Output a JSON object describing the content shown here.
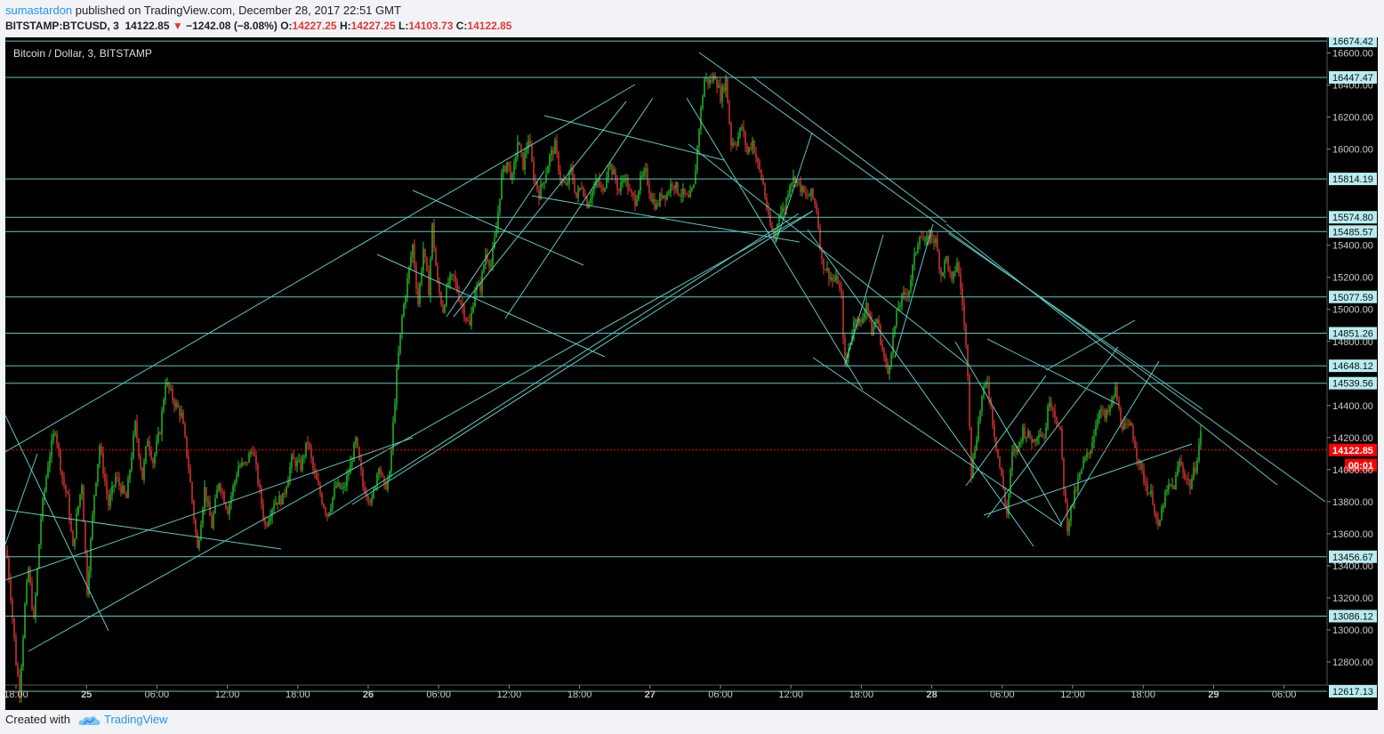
{
  "header": {
    "publisher": "sumastardon",
    "published_text": " published on TradingView.com, December 28, 2017 22:51 GMT",
    "symbol": "BITSTAMP:BTCUSD, 3",
    "last": "14122.85",
    "change": "−1242.08 (−8.08%)",
    "open_label": "O:",
    "open": "14227.25",
    "high_label": "H:",
    "high": "14227.25",
    "low_label": "L:",
    "low": "14103.73",
    "close_label": "C:",
    "close": "14122.85"
  },
  "chart_title": "Bitcoin / Dollar, 3, BITSTAMP",
  "footer": {
    "created_with": "Created with",
    "brand": "TradingView"
  },
  "colors": {
    "background": "#000000",
    "line": "#5ec8c0",
    "up": "#26c828",
    "down": "#e53935",
    "price_label_bg": "#b8ecf0",
    "last_price_bg": "#ff0000",
    "accent": "#2196f3"
  },
  "chart_data": {
    "type": "candlestick",
    "title": "Bitcoin / Dollar, 3, BITSTAMP",
    "x_ticks": [
      "18:00",
      "25",
      "06:00",
      "12:00",
      "18:00",
      "26",
      "06:00",
      "12:00",
      "18:00",
      "27",
      "06:00",
      "12:00",
      "18:00",
      "28",
      "06:00",
      "12:00",
      "18:00",
      "29",
      "06:00"
    ],
    "y_ticks": [
      16600,
      16400,
      16200,
      16000,
      15400,
      15200,
      15000,
      14800,
      14400,
      14200,
      14000,
      13800,
      13600,
      13400,
      13200,
      13000,
      12800
    ],
    "ylim": [
      12450,
      16740
    ],
    "horizontal_levels": [
      16674.42,
      16447.47,
      15814.19,
      15574.8,
      15485.57,
      15077.59,
      14851.26,
      14648.12,
      14539.56,
      13456.67,
      13086.12,
      12617.13
    ],
    "last_price": 14122.85,
    "countdown": "00:01",
    "price_path": [
      [
        0,
        13560
      ],
      [
        6,
        13220
      ],
      [
        12,
        12800
      ],
      [
        16,
        12620
      ],
      [
        22,
        13150
      ],
      [
        26,
        13380
      ],
      [
        32,
        13050
      ],
      [
        40,
        13700
      ],
      [
        48,
        14040
      ],
      [
        56,
        14260
      ],
      [
        64,
        13950
      ],
      [
        70,
        13820
      ],
      [
        76,
        13500
      ],
      [
        80,
        13700
      ],
      [
        86,
        13920
      ],
      [
        92,
        13250
      ],
      [
        100,
        13850
      ],
      [
        106,
        14150
      ],
      [
        116,
        13780
      ],
      [
        124,
        13950
      ],
      [
        136,
        13820
      ],
      [
        146,
        14280
      ],
      [
        154,
        13950
      ],
      [
        160,
        14200
      ],
      [
        166,
        14050
      ],
      [
        174,
        14250
      ],
      [
        180,
        14550
      ],
      [
        190,
        14420
      ],
      [
        198,
        14340
      ],
      [
        206,
        14020
      ],
      [
        212,
        13700
      ],
      [
        216,
        13500
      ],
      [
        224,
        13880
      ],
      [
        232,
        13650
      ],
      [
        240,
        13930
      ],
      [
        250,
        13750
      ],
      [
        262,
        14020
      ],
      [
        270,
        14030
      ],
      [
        278,
        14140
      ],
      [
        284,
        13930
      ],
      [
        292,
        13650
      ],
      [
        302,
        13800
      ],
      [
        312,
        13820
      ],
      [
        322,
        14060
      ],
      [
        332,
        14020
      ],
      [
        340,
        14180
      ],
      [
        346,
        14000
      ],
      [
        356,
        13810
      ],
      [
        362,
        13720
      ],
      [
        372,
        13900
      ],
      [
        380,
        13870
      ],
      [
        386,
        13980
      ],
      [
        394,
        14180
      ],
      [
        402,
        13900
      ],
      [
        412,
        13800
      ],
      [
        420,
        14040
      ],
      [
        426,
        13880
      ],
      [
        432,
        13960
      ],
      [
        440,
        14600
      ],
      [
        446,
        14950
      ],
      [
        452,
        15180
      ],
      [
        458,
        15400
      ],
      [
        464,
        15040
      ],
      [
        470,
        15380
      ],
      [
        476,
        15120
      ],
      [
        480,
        15520
      ],
      [
        486,
        15150
      ],
      [
        492,
        15000
      ],
      [
        498,
        15170
      ],
      [
        504,
        15200
      ],
      [
        510,
        15080
      ],
      [
        516,
        14980
      ],
      [
        522,
        14890
      ],
      [
        528,
        15130
      ],
      [
        534,
        15140
      ],
      [
        540,
        15350
      ],
      [
        546,
        15280
      ],
      [
        552,
        15500
      ],
      [
        558,
        15830
      ],
      [
        564,
        15920
      ],
      [
        570,
        15810
      ],
      [
        576,
        16050
      ],
      [
        582,
        15900
      ],
      [
        588,
        16070
      ],
      [
        594,
        15830
      ],
      [
        600,
        15720
      ],
      [
        606,
        15820
      ],
      [
        612,
        15950
      ],
      [
        618,
        16020
      ],
      [
        624,
        15820
      ],
      [
        630,
        15760
      ],
      [
        636,
        15870
      ],
      [
        642,
        15700
      ],
      [
        648,
        15780
      ],
      [
        654,
        15660
      ],
      [
        660,
        15740
      ],
      [
        666,
        15800
      ],
      [
        672,
        15720
      ],
      [
        678,
        15920
      ],
      [
        684,
        15840
      ],
      [
        690,
        15740
      ],
      [
        696,
        15840
      ],
      [
        702,
        15720
      ],
      [
        708,
        15680
      ],
      [
        714,
        15800
      ],
      [
        720,
        15850
      ],
      [
        726,
        15700
      ],
      [
        732,
        15640
      ],
      [
        738,
        15720
      ],
      [
        744,
        15720
      ],
      [
        750,
        15800
      ],
      [
        756,
        15740
      ],
      [
        762,
        15720
      ],
      [
        768,
        15680
      ],
      [
        774,
        15760
      ],
      [
        780,
        16140
      ],
      [
        786,
        16440
      ],
      [
        792,
        16420
      ],
      [
        798,
        16460
      ],
      [
        804,
        16330
      ],
      [
        810,
        16430
      ],
      [
        816,
        16040
      ],
      [
        822,
        16050
      ],
      [
        828,
        16140
      ],
      [
        834,
        15980
      ],
      [
        840,
        16050
      ],
      [
        846,
        15900
      ],
      [
        852,
        15780
      ],
      [
        858,
        15560
      ],
      [
        864,
        15440
      ],
      [
        870,
        15600
      ],
      [
        876,
        15630
      ],
      [
        882,
        15800
      ],
      [
        888,
        15820
      ],
      [
        894,
        15760
      ],
      [
        900,
        15700
      ],
      [
        906,
        15720
      ],
      [
        912,
        15630
      ],
      [
        918,
        15300
      ],
      [
        924,
        15240
      ],
      [
        930,
        15180
      ],
      [
        936,
        15180
      ],
      [
        940,
        15060
      ],
      [
        944,
        14640
      ],
      [
        950,
        14810
      ],
      [
        956,
        14960
      ],
      [
        962,
        14900
      ],
      [
        968,
        15050
      ],
      [
        974,
        14860
      ],
      [
        980,
        14940
      ],
      [
        986,
        14750
      ],
      [
        992,
        14600
      ],
      [
        998,
        14830
      ],
      [
        1004,
        15020
      ],
      [
        1010,
        15080
      ],
      [
        1016,
        15130
      ],
      [
        1022,
        15320
      ],
      [
        1028,
        15480
      ],
      [
        1034,
        15400
      ],
      [
        1040,
        15470
      ],
      [
        1046,
        15420
      ],
      [
        1052,
        15220
      ],
      [
        1058,
        15320
      ],
      [
        1064,
        15160
      ],
      [
        1070,
        15300
      ],
      [
        1076,
        15040
      ],
      [
        1082,
        14620
      ],
      [
        1086,
        13980
      ],
      [
        1092,
        14220
      ],
      [
        1098,
        14450
      ],
      [
        1104,
        14560
      ],
      [
        1110,
        14300
      ],
      [
        1116,
        14080
      ],
      [
        1122,
        13880
      ],
      [
        1126,
        13720
      ],
      [
        1132,
        14100
      ],
      [
        1138,
        14130
      ],
      [
        1144,
        14250
      ],
      [
        1150,
        14210
      ],
      [
        1156,
        14180
      ],
      [
        1162,
        14250
      ],
      [
        1168,
        14200
      ],
      [
        1174,
        14450
      ],
      [
        1180,
        14350
      ],
      [
        1186,
        14220
      ],
      [
        1190,
        13900
      ],
      [
        1194,
        13650
      ],
      [
        1200,
        13800
      ],
      [
        1206,
        13920
      ],
      [
        1212,
        14040
      ],
      [
        1218,
        14100
      ],
      [
        1224,
        14230
      ],
      [
        1230,
        14390
      ],
      [
        1236,
        14320
      ],
      [
        1242,
        14380
      ],
      [
        1248,
        14500
      ],
      [
        1254,
        14300
      ],
      [
        1260,
        14250
      ],
      [
        1266,
        14270
      ],
      [
        1272,
        14100
      ],
      [
        1278,
        13980
      ],
      [
        1284,
        13880
      ],
      [
        1290,
        13820
      ],
      [
        1296,
        13620
      ],
      [
        1302,
        13800
      ],
      [
        1308,
        13890
      ],
      [
        1314,
        13900
      ],
      [
        1320,
        14050
      ],
      [
        1326,
        13970
      ],
      [
        1332,
        13900
      ],
      [
        1338,
        14020
      ],
      [
        1344,
        14220
      ],
      [
        1348,
        14120
      ],
      [
        1352,
        14123
      ]
    ]
  }
}
